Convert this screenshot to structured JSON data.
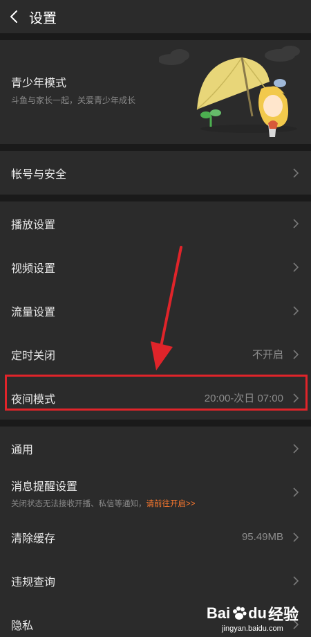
{
  "header": {
    "title": "设置",
    "back_icon": "chevron-left-icon"
  },
  "teen_mode": {
    "title": "青少年模式",
    "subtitle": "斗鱼与家长一起，关爱青少年成长"
  },
  "account": {
    "label": "帐号与安全"
  },
  "settings_group": [
    {
      "label": "播放设置",
      "value": ""
    },
    {
      "label": "视频设置",
      "value": ""
    },
    {
      "label": "流量设置",
      "value": ""
    },
    {
      "label": "定时关闭",
      "value": "不开启"
    },
    {
      "label": "夜间模式",
      "value": "20:00-次日 07:00"
    }
  ],
  "general": {
    "label": "通用"
  },
  "notify": {
    "label": "消息提醒设置",
    "sub_text": "关闭状态无法接收开播、私信等通知，",
    "sub_link": "请前往开启>>"
  },
  "cache": {
    "label": "清除缓存",
    "value": "95.49MB"
  },
  "violation": {
    "label": "违规查询"
  },
  "privacy": {
    "label": "隐私"
  },
  "watermark": {
    "brand_a": "Bai",
    "brand_b": "du",
    "brand_c": "经验",
    "site": "jingyan.baidu.com"
  },
  "colors": {
    "highlight": "#e0242a",
    "link": "#ff7a2e",
    "background": "#2b2b2b"
  }
}
